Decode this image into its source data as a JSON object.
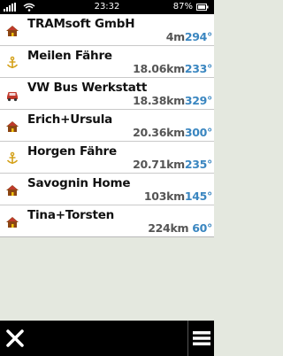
{
  "status_bar": {
    "time": "23:32",
    "battery_percent": "87%"
  },
  "waypoints": [
    {
      "name": "TRAMsoft GmbH",
      "distance": "4m",
      "bearing": "294°",
      "icon": "house-icon"
    },
    {
      "name": "Meilen Fähre",
      "distance": "18.06km",
      "bearing": "233°",
      "icon": "anchor-icon"
    },
    {
      "name": "VW Bus Werkstatt",
      "distance": "18.38km",
      "bearing": "329°",
      "icon": "car-icon"
    },
    {
      "name": "Erich+Ursula",
      "distance": "20.36km",
      "bearing": "300°",
      "icon": "house-icon"
    },
    {
      "name": "Horgen Fähre",
      "distance": "20.71km",
      "bearing": "235°",
      "icon": "anchor-icon"
    },
    {
      "name": "Savognin Home",
      "distance": "103km",
      "bearing": "145°",
      "icon": "house-icon"
    },
    {
      "name": "Tina+Torsten",
      "distance": "224km",
      "bearing": " 60°",
      "icon": "house-icon"
    }
  ],
  "bottom_bar": {
    "close_icon": "close-icon",
    "menu_icon": "menu-icon"
  },
  "colors": {
    "bearing": "#3a86c0",
    "distance": "#555555",
    "background": "#e4e8df"
  }
}
